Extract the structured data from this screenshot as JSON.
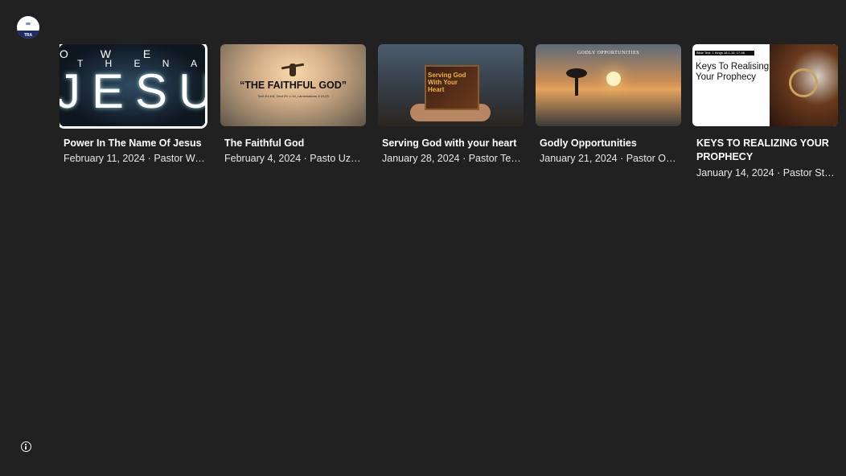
{
  "profile": {
    "initials": "TRA"
  },
  "videos": [
    {
      "title": "Power In The Name Of Jesus",
      "meta": "February 11, 2024 · Pastor Wa…",
      "thumb_text": {
        "line1": "O W E",
        "line2": "T H E  N A M E  O",
        "big": "JESUS"
      }
    },
    {
      "title": "The Faithful God",
      "meta": "February 4, 2024 · Pasto Uzo …",
      "thumb_text": {
        "headline": "“THE FAITHFUL GOD”",
        "subline": "Text: Ex 6:8, Deut 29: 1-15, Lamentations 3:19-23"
      }
    },
    {
      "title": "Serving God with your heart",
      "meta": "January 28, 2024 · Pastor Te…",
      "thumb_text": {
        "headline": "Serving God With Your Heart"
      }
    },
    {
      "title": "Godly Opportunities",
      "meta": "January 21, 2024 · Pastor Obi…",
      "thumb_text": {
        "headline": "GODLY OPPORTUNITIES"
      }
    },
    {
      "title": "KEYS TO REALIZING YOUR PROPHECY",
      "meta": "January 14, 2024 · Pastor Ste…",
      "thumb_text": {
        "strip": "Bible Text: 1 Kings 18:1-15, 17-46",
        "headline": "Keys To Realising Your Prophecy"
      }
    }
  ],
  "colors": {
    "background": "#212121",
    "focus_ring": "#ffffff",
    "text_secondary": "#e8e8e8"
  },
  "icons": {
    "info": "info-icon",
    "avatar": "channel-avatar"
  }
}
